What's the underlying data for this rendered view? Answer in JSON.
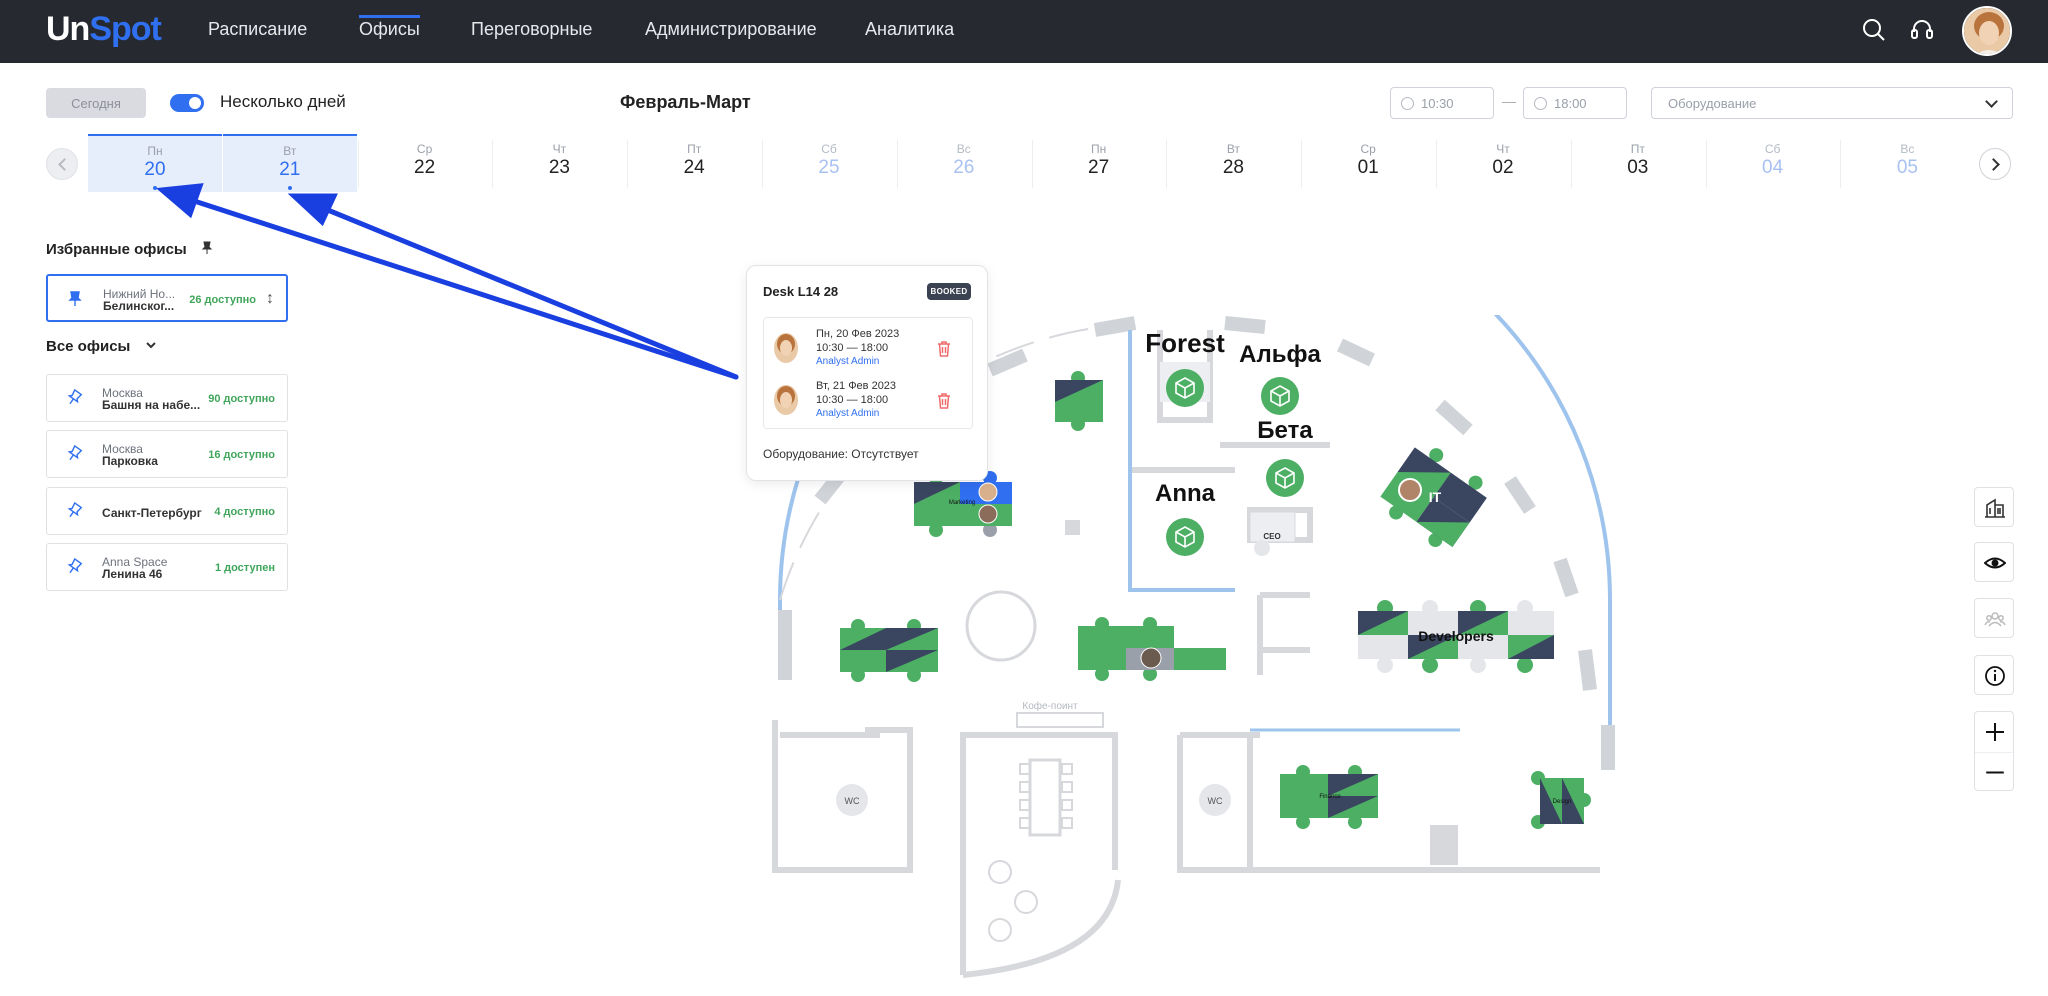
{
  "app": {
    "logo_un": "Un",
    "logo_spot": "Spot",
    "nav": [
      "Расписание",
      "Офисы",
      "Переговорные",
      "Администрирование",
      "Аналитика"
    ],
    "active_nav": "Офисы",
    "icons": [
      "search-icon",
      "support-headset-icon",
      "user-avatar"
    ]
  },
  "toolbar": {
    "today_label": "Сегодня",
    "multi_day_label": "Несколько дней",
    "multi_day_on": true,
    "period": "Февраль-Март",
    "time_from": "10:30",
    "time_to": "18:00",
    "time_separator": "—",
    "equipment_placeholder": "Оборудование"
  },
  "calendar": [
    {
      "dow": "Пн",
      "num": "20",
      "selected": true,
      "weekend": false,
      "dot": true
    },
    {
      "dow": "Вт",
      "num": "21",
      "selected": true,
      "weekend": false,
      "dot": true
    },
    {
      "dow": "Ср",
      "num": "22",
      "selected": false,
      "weekend": false,
      "dot": false
    },
    {
      "dow": "Чт",
      "num": "23",
      "selected": false,
      "weekend": false,
      "dot": false
    },
    {
      "dow": "Пт",
      "num": "24",
      "selected": false,
      "weekend": false,
      "dot": false
    },
    {
      "dow": "Сб",
      "num": "25",
      "selected": false,
      "weekend": true,
      "dot": false
    },
    {
      "dow": "Вс",
      "num": "26",
      "selected": false,
      "weekend": true,
      "dot": false
    },
    {
      "dow": "Пн",
      "num": "27",
      "selected": false,
      "weekend": false,
      "dot": false
    },
    {
      "dow": "Вт",
      "num": "28",
      "selected": false,
      "weekend": false,
      "dot": false
    },
    {
      "dow": "Ср",
      "num": "01",
      "selected": false,
      "weekend": false,
      "dot": false
    },
    {
      "dow": "Чт",
      "num": "02",
      "selected": false,
      "weekend": false,
      "dot": false
    },
    {
      "dow": "Пт",
      "num": "03",
      "selected": false,
      "weekend": false,
      "dot": false
    },
    {
      "dow": "Сб",
      "num": "04",
      "selected": false,
      "weekend": true,
      "dot": false
    },
    {
      "dow": "Вс",
      "num": "05",
      "selected": false,
      "weekend": true,
      "dot": false
    }
  ],
  "sidebar": {
    "favorites_title": "Избранные офисы",
    "favorite": {
      "city": "Нижний Но...",
      "name": "Белинског...",
      "avail": "26 доступно"
    },
    "all_title": "Все офисы",
    "offices": [
      {
        "city": "Москва",
        "name": "Башня на набе...",
        "avail": "90 доступно"
      },
      {
        "city": "Москва",
        "name": "Парковка",
        "avail": "16 доступно"
      },
      {
        "city": "",
        "name": "Санкт-Петербург",
        "avail": "4 доступно"
      },
      {
        "city": "Anna Space",
        "name": "Ленина 46",
        "avail": "1 доступен"
      }
    ]
  },
  "tooltip": {
    "desk": "Desk L14 28",
    "badge": "BOOKED",
    "bookings": [
      {
        "date": "Пн, 20 Фев 2023",
        "time": "10:30 — 18:00",
        "user": "Analyst Admin"
      },
      {
        "date": "Вт, 21 Фев 2023",
        "time": "10:30 — 18:00",
        "user": "Analyst Admin"
      }
    ],
    "equipment": "Оборудование: Отсутствует"
  },
  "map": {
    "rooms": [
      "Forest",
      "Альфа",
      "Бета",
      "Anna",
      "CEO",
      "IT",
      "Developers",
      "Кофе-поинт",
      "WC",
      "WC",
      "Marketing",
      "Finance",
      "Design"
    ],
    "colors": {
      "desk": "#4caf64",
      "desk_dark": "#3a4660",
      "wall": "#d6d8dc",
      "glass": "#9ec4ee",
      "accent": "#2f6ff0"
    }
  },
  "right_tools": [
    "building-icon",
    "eye-icon",
    "team-icon",
    "info-icon",
    "zoom-in-icon",
    "zoom-out-icon"
  ]
}
